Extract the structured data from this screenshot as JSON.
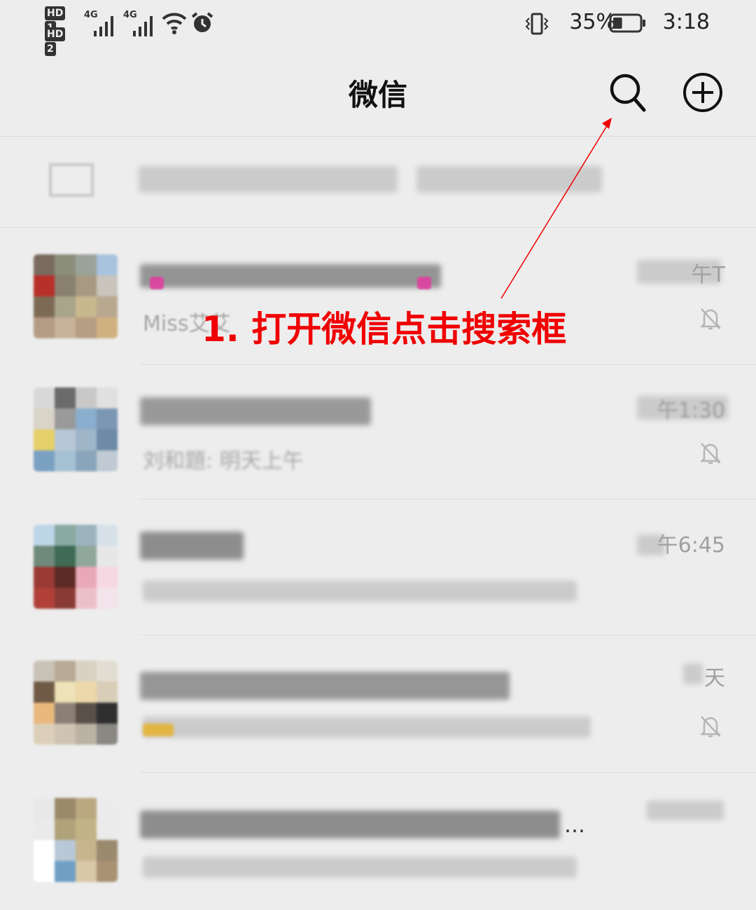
{
  "status_bar": {
    "sim1_label": "HD",
    "sim1_num": "1",
    "sim2_label": "HD",
    "sim2_num": "2",
    "net1": "4G",
    "net2": "4G",
    "battery_percent": "35%",
    "battery_level": 0.35,
    "time": "3:18",
    "icons": [
      "signal-icon",
      "signal-icon",
      "wifi-icon",
      "alarm-icon",
      "vibrate-icon",
      "battery-icon"
    ]
  },
  "header": {
    "title": "微信",
    "search_icon": "search-icon",
    "add_icon": "plus-circle-icon"
  },
  "chats": [
    {
      "type": "official-accounts",
      "time": "",
      "preview": "",
      "muted": false
    },
    {
      "time": "午T",
      "preview": "Miss艾艾",
      "muted": true
    },
    {
      "time": "午1:30",
      "preview": "刘和題: 明天上午",
      "muted": true
    },
    {
      "time": "午6:45",
      "preview": "",
      "muted": false
    },
    {
      "time": "天",
      "preview": "",
      "muted": true
    },
    {
      "time": "",
      "preview": "",
      "muted": false,
      "ellipsis": "…"
    }
  ],
  "annotation": {
    "text": "1. 打开微信点击搜索框",
    "color": "#f00000"
  }
}
